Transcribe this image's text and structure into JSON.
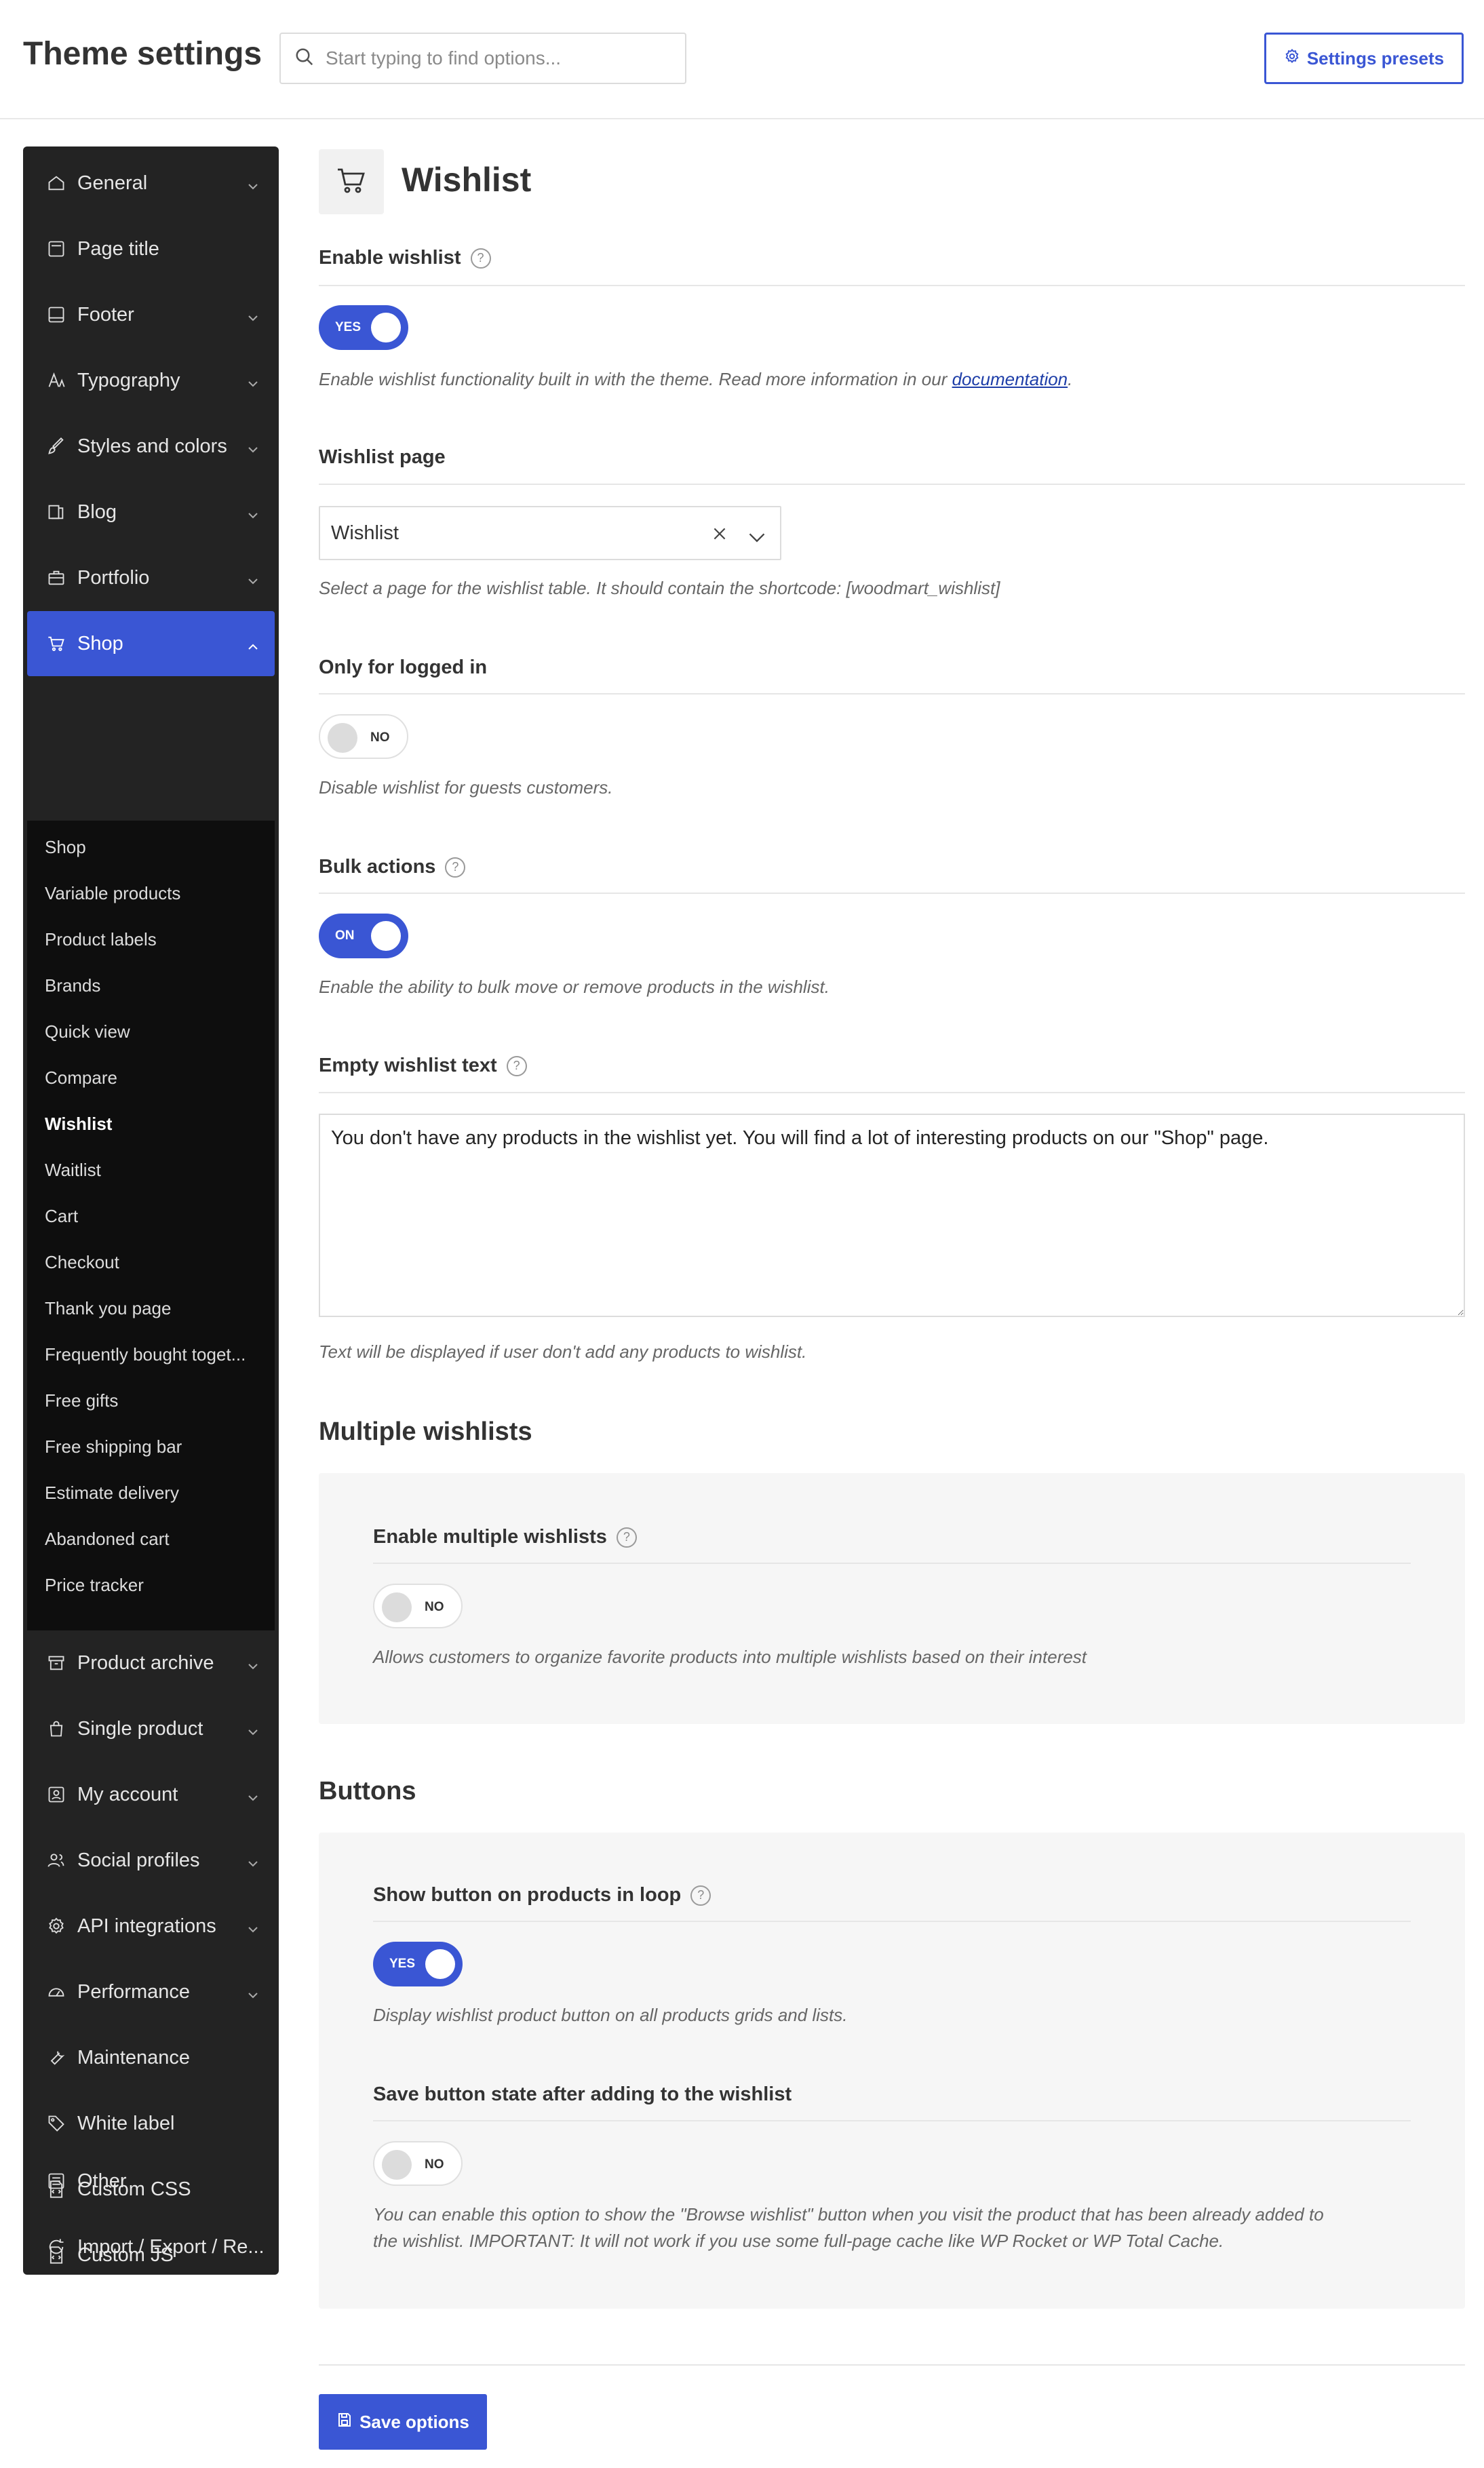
{
  "header": {
    "title": "Theme settings",
    "search_placeholder": "Start typing to find options...",
    "presets_label": "Settings presets"
  },
  "sidebar": {
    "items": [
      {
        "label": "General",
        "icon": "home-icon",
        "chevron": true
      },
      {
        "label": "Page title",
        "icon": "page-title-icon",
        "chevron": false
      },
      {
        "label": "Footer",
        "icon": "footer-icon",
        "chevron": true
      },
      {
        "label": "Typography",
        "icon": "typography-icon",
        "chevron": true
      },
      {
        "label": "Styles and colors",
        "icon": "brush-icon",
        "chevron": true
      },
      {
        "label": "Blog",
        "icon": "blog-icon",
        "chevron": true
      },
      {
        "label": "Portfolio",
        "icon": "briefcase-icon",
        "chevron": true
      },
      {
        "label": "Shop",
        "icon": "cart-icon",
        "chevron": true,
        "active": true
      }
    ],
    "shop_sub": [
      "Shop",
      "Variable products",
      "Product labels",
      "Brands",
      "Quick view",
      "Compare",
      "Wishlist",
      "Waitlist",
      "Cart",
      "Checkout",
      "Thank you page",
      "Frequently bought toget...",
      "Free gifts",
      "Free shipping bar",
      "Estimate delivery",
      "Abandoned cart",
      "Price tracker"
    ],
    "current_sub": "Wishlist",
    "items_after": [
      {
        "label": "Product archive",
        "icon": "archive-icon",
        "chevron": true
      },
      {
        "label": "Single product",
        "icon": "bag-icon",
        "chevron": true
      },
      {
        "label": "My account",
        "icon": "account-icon",
        "chevron": true
      },
      {
        "label": "Social profiles",
        "icon": "people-icon",
        "chevron": true
      },
      {
        "label": "API integrations",
        "icon": "gear-icon",
        "chevron": true
      },
      {
        "label": "Performance",
        "icon": "gauge-icon",
        "chevron": true
      },
      {
        "label": "Maintenance",
        "icon": "wrench-icon",
        "chevron": false
      },
      {
        "label": "White label",
        "icon": "tag-icon",
        "chevron": false
      },
      {
        "label": "Custom CSS",
        "icon": "css-file-icon",
        "chevron": false
      },
      {
        "label": "Custom JS",
        "icon": "js-file-icon",
        "chevron": false
      },
      {
        "label": "Other",
        "icon": "sliders-icon",
        "chevron": false
      },
      {
        "label": "Import / Export / Re...",
        "icon": "refresh-icon",
        "chevron": false
      }
    ]
  },
  "section": {
    "title": "Wishlist",
    "icon": "cart-icon"
  },
  "options": {
    "enable_wishlist": {
      "title": "Enable wishlist",
      "state": "YES",
      "desc_prefix": "Enable wishlist functionality built in with the theme. Read more information in our ",
      "desc_link": "documentation",
      "desc_suffix": "."
    },
    "wishlist_page": {
      "title": "Wishlist page",
      "value": "Wishlist",
      "desc": "Select a page for the wishlist table. It should contain the shortcode: [woodmart_wishlist]"
    },
    "logged_in": {
      "title": "Only for logged in",
      "state": "NO",
      "desc": "Disable wishlist for guests customers."
    },
    "bulk_actions": {
      "title": "Bulk actions",
      "state": "ON",
      "desc": "Enable the ability to bulk move or remove products in the wishlist."
    },
    "empty_text": {
      "title": "Empty wishlist text",
      "value": "You don't have any products in the wishlist yet. You will find a lot of interesting products on our \"Shop\" page.",
      "desc": "Text will be displayed if user don't add any products to wishlist."
    }
  },
  "multiple": {
    "group_title": "Multiple wishlists",
    "enable": {
      "title": "Enable multiple wishlists",
      "state": "NO",
      "desc": "Allows customers to organize favorite products into multiple wishlists based on their interest"
    }
  },
  "buttons": {
    "group_title": "Buttons",
    "show_loop": {
      "title": "Show button on products in loop",
      "state": "YES",
      "desc": "Display wishlist product button on all products grids and lists."
    },
    "save_state": {
      "title": "Save button state after adding to the wishlist",
      "state": "NO",
      "desc_line1": "You can enable this option to show the \"Browse wishlist\" button when you visit the product that has been already added to",
      "desc_line2": "the wishlist. IMPORTANT: It will not work if you use some full-page cache like WP Rocket or WP Total Cache."
    }
  },
  "footer": {
    "save_label": "Save options"
  },
  "colors": {
    "accent": "#3a56d4",
    "sidebar_bg": "#232323",
    "subnav_bg": "#0e0e0e"
  }
}
